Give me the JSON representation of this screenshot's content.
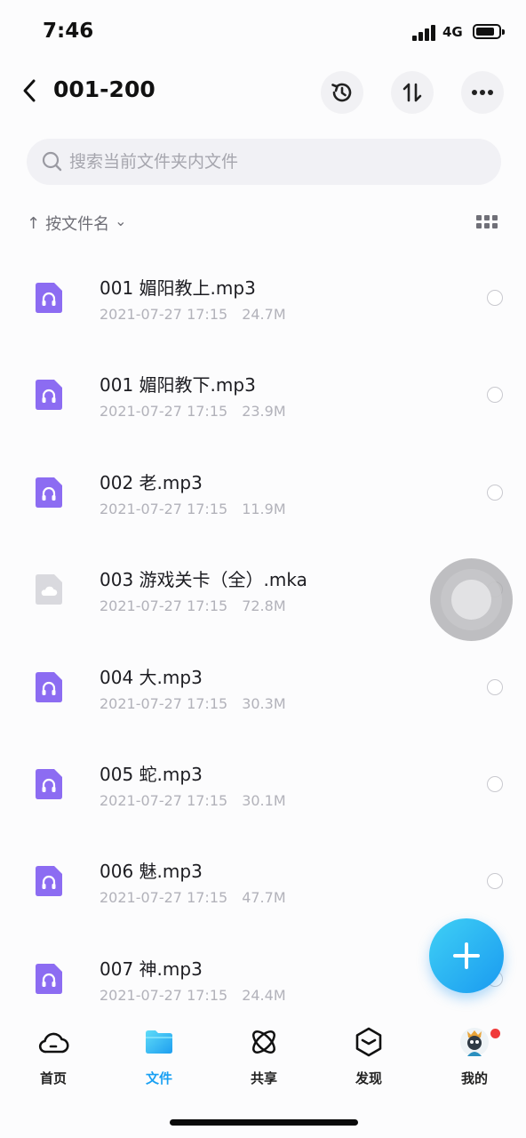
{
  "status_bar": {
    "time": "7:46",
    "network": "4G"
  },
  "header": {
    "title": "001-200"
  },
  "search": {
    "placeholder": "搜索当前文件夹内文件"
  },
  "sort": {
    "arrow": "↑",
    "label": "按文件名",
    "caret": "⌄"
  },
  "files": [
    {
      "name": "001 媚阳教上.mp3",
      "date": "2021-07-27 17:15",
      "size": "24.7M",
      "type": "audio"
    },
    {
      "name": "001 媚阳教下.mp3",
      "date": "2021-07-27 17:15",
      "size": "23.9M",
      "type": "audio"
    },
    {
      "name": "002 老.mp3",
      "date": "2021-07-27 17:15",
      "size": "11.9M",
      "type": "audio"
    },
    {
      "name": "003 游戏关卡（全）.mka",
      "date": "2021-07-27 17:15",
      "size": "72.8M",
      "type": "unknown"
    },
    {
      "name": "004 大.mp3",
      "date": "2021-07-27 17:15",
      "size": "30.3M",
      "type": "audio"
    },
    {
      "name": "005 蛇.mp3",
      "date": "2021-07-27 17:15",
      "size": "30.1M",
      "type": "audio"
    },
    {
      "name": "006 魅.mp3",
      "date": "2021-07-27 17:15",
      "size": "47.7M",
      "type": "audio"
    },
    {
      "name": "007 神.mp3",
      "date": "2021-07-27 17:15",
      "size": "24.4M",
      "type": "audio"
    }
  ],
  "tabs": [
    {
      "label": "首页",
      "icon": "cloud-icon",
      "active": false
    },
    {
      "label": "文件",
      "icon": "folder-icon",
      "active": true
    },
    {
      "label": "共享",
      "icon": "atom-icon",
      "active": false
    },
    {
      "label": "发现",
      "icon": "cube-icon",
      "active": false
    },
    {
      "label": "我的",
      "icon": "avatar-icon",
      "active": false
    }
  ],
  "colors": {
    "accent": "#1aa0f2",
    "audio_icon": "#8c6cf2",
    "unknown_icon": "#d9d9de"
  }
}
